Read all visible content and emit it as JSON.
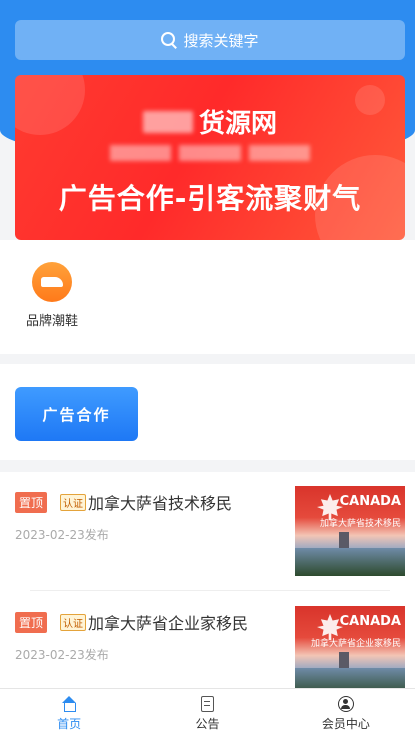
{
  "search": {
    "placeholder": "搜索关键字"
  },
  "banner": {
    "site_name": "货源网",
    "slogan": "广告合作-引客流聚财气"
  },
  "categories": [
    {
      "label": "品牌潮鞋",
      "icon": "sneaker-icon"
    }
  ],
  "ad_section": {
    "button_label": "广告合作"
  },
  "list": [
    {
      "badge": "置顶",
      "cert": "认证",
      "title": "加拿大萨省技术移民",
      "date": "2023-02-23发布",
      "thumb_heading": "CANADA",
      "thumb_caption": "加拿大萨省技术移民"
    },
    {
      "badge": "置顶",
      "cert": "认证",
      "title": "加拿大萨省企业家移民",
      "date": "2023-02-23发布",
      "thumb_heading": "CANADA",
      "thumb_caption": "加拿大萨省企业家移民"
    }
  ],
  "tabbar": [
    {
      "label": "首页",
      "icon": "home-icon",
      "active": true
    },
    {
      "label": "公告",
      "icon": "notice-icon",
      "active": false
    },
    {
      "label": "会员中心",
      "icon": "user-icon",
      "active": false
    }
  ],
  "colors": {
    "primary": "#2d8cf0",
    "badge": "#f06d4f",
    "banner": "#ff3b30"
  }
}
